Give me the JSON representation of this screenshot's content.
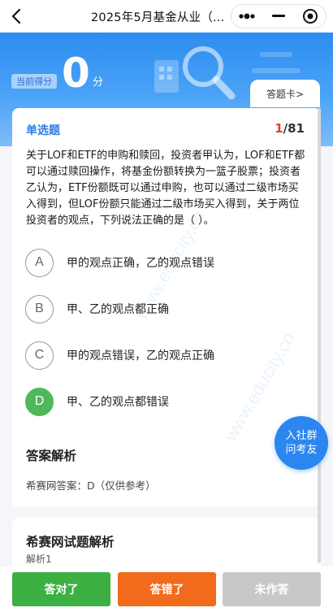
{
  "nav": {
    "title": "2025年5月基金从业（..."
  },
  "header": {
    "score_label": "当前得分",
    "score_value": "0",
    "score_unit": "分",
    "answer_card_label": "答题卡>"
  },
  "question": {
    "type": "单选题",
    "current": "1",
    "total": "/81",
    "text": "关于LOF和ETF的申购和赎回，投资者甲认为，LOF和ETF都可以通过赎回操作，将基金份额转换为一篮子股票；投资者乙认为，ETF份额既可以通过申购，也可以通过二级市场买入得到，但LOF份额只能通过二级市场买入得到，关于两位投资者的观点，下列说法正确的是（  ）。",
    "options": [
      {
        "letter": "A",
        "text": "甲的观点正确，乙的观点错误"
      },
      {
        "letter": "B",
        "text": "甲、乙的观点都正确"
      },
      {
        "letter": "C",
        "text": "甲的观点错误，乙的观点正确"
      },
      {
        "letter": "D",
        "text": "甲、乙的观点都错误"
      }
    ],
    "selected": "D"
  },
  "analysis": {
    "title": "答案解析",
    "answer_text": "希赛网答案：D（仅供参考）"
  },
  "analysis2": {
    "title": "希赛网试题解析",
    "sub": "解析1"
  },
  "float_button": {
    "line1": "入社群",
    "line2": "问考友"
  },
  "bottom": {
    "correct_label": "答对了",
    "wrong_label": "答错了",
    "skip_label": "未作答"
  },
  "colors": {
    "accent": "#2d8cf0",
    "selected": "#4fb85a",
    "correct_btn": "#3cb043",
    "wrong_btn": "#f26a1b",
    "skip_btn": "#c8c8c8",
    "progress_current": "#e53e2e"
  }
}
